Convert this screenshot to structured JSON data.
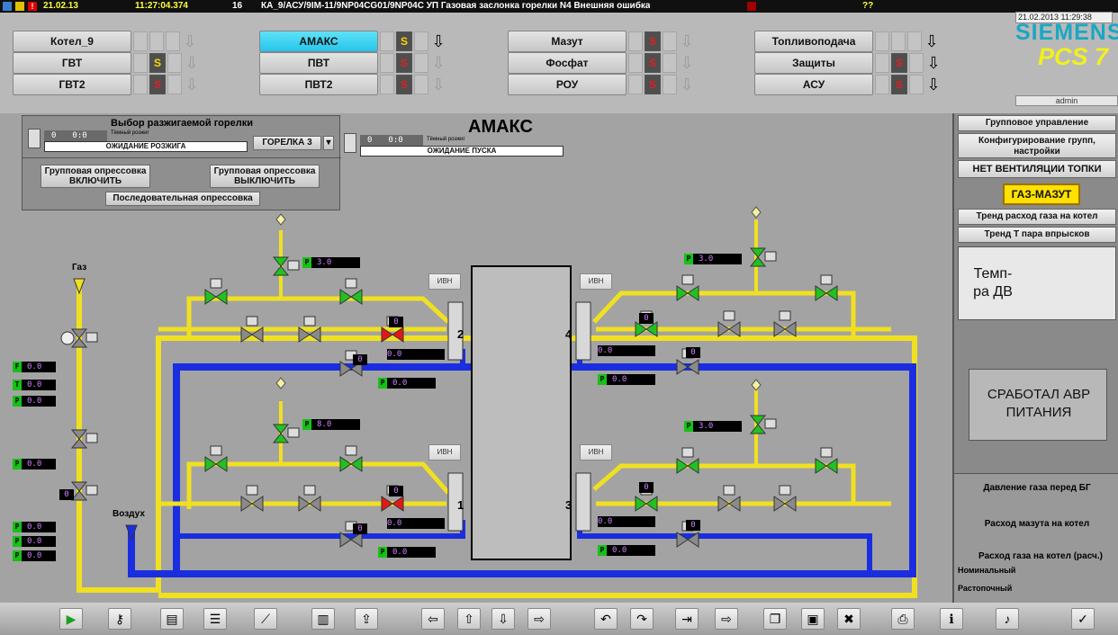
{
  "alarm": {
    "date": "21.02.13",
    "time": "11:27:04.374",
    "num": "16",
    "message": "КА_9/АСУ/9IM-11/9NP04CG01/9NP04C УП Газовая заслонка горелки N4 Внешняя ошибка",
    "code": "??"
  },
  "header": {
    "datetime": "21.02.2013 11:29:38",
    "user": "admin",
    "logo_brand": "SIEMENS",
    "logo_product": "PCS 7",
    "nav": [
      {
        "label": "Котел_9",
        "s": ""
      },
      {
        "label": "АМАКС",
        "s": "S"
      },
      {
        "label": "Мазут",
        "s": "S"
      },
      {
        "label": "Топливоподача",
        "s": ""
      },
      {
        "label": "ГВТ",
        "s": "S"
      },
      {
        "label": "ПВТ",
        "s": "S"
      },
      {
        "label": "Фосфат",
        "s": "S"
      },
      {
        "label": "Защиты",
        "s": "S"
      },
      {
        "label": "ГВТ2",
        "s": "S"
      },
      {
        "label": "ПВТ2",
        "s": "S"
      },
      {
        "label": "РОУ",
        "s": "S"
      },
      {
        "label": "АСУ",
        "s": "S"
      }
    ]
  },
  "main": {
    "title": "АМАКС",
    "burner_select": {
      "title": "Выбор разжигаемой горелки",
      "val1": "0",
      "val2": "0:0",
      "mode": "Тёмный розжиг",
      "status": "ОЖИДАНИЕ РОЗЖИГА",
      "burner": "ГОРЕЛКА 3",
      "press_on": "Групповая опрессовка\nВКЛЮЧИТЬ",
      "press_off": "Групповая опрессовка\nВЫКЛЮЧИТЬ",
      "seq": "Последовательная опрессовка"
    },
    "start": {
      "val1": "0",
      "val2": "0:0",
      "mode": "Тёмный розжиг",
      "status": "ОЖИДАНИЕ ПУСКА"
    },
    "gas_label": "Газ",
    "air_label": "Воздух",
    "ivn": "ИВН",
    "burners": [
      "2",
      "4",
      "1",
      "3"
    ],
    "tags": {
      "P": "P",
      "T": "T",
      "F": "F",
      "p30": "3.0",
      "p00": "0.0",
      "v0": "0",
      "p80": "8.0"
    }
  },
  "right": {
    "group_control": "Групповое управление",
    "config": "Конфигурирование групп, настройки",
    "no_vent": "НЕТ ВЕНТИЛЯЦИИ ТОПКИ",
    "gas_oil": "ГАЗ-МАЗУТ",
    "trend_gas": "Тренд расход газа на котел",
    "trend_t": "Тренд Т пара впрысков",
    "temp_dv": "Темп-ра ДВ",
    "avr": "СРАБОТАЛ АВР ПИТАНИЯ",
    "gas_press": "Давление газа перед БГ",
    "oil_flow": "Расход мазута на котел",
    "gas_flow": "Расход газа на котел (расч.)",
    "nominal": "Номинальный",
    "ignition": "Растопочный"
  },
  "colors": {
    "gas": "#f0e020",
    "air": "#1a2ee0",
    "valve_open": "#22c022",
    "valve_closed": "#e01818",
    "valve_off": "#8a8a8a"
  }
}
